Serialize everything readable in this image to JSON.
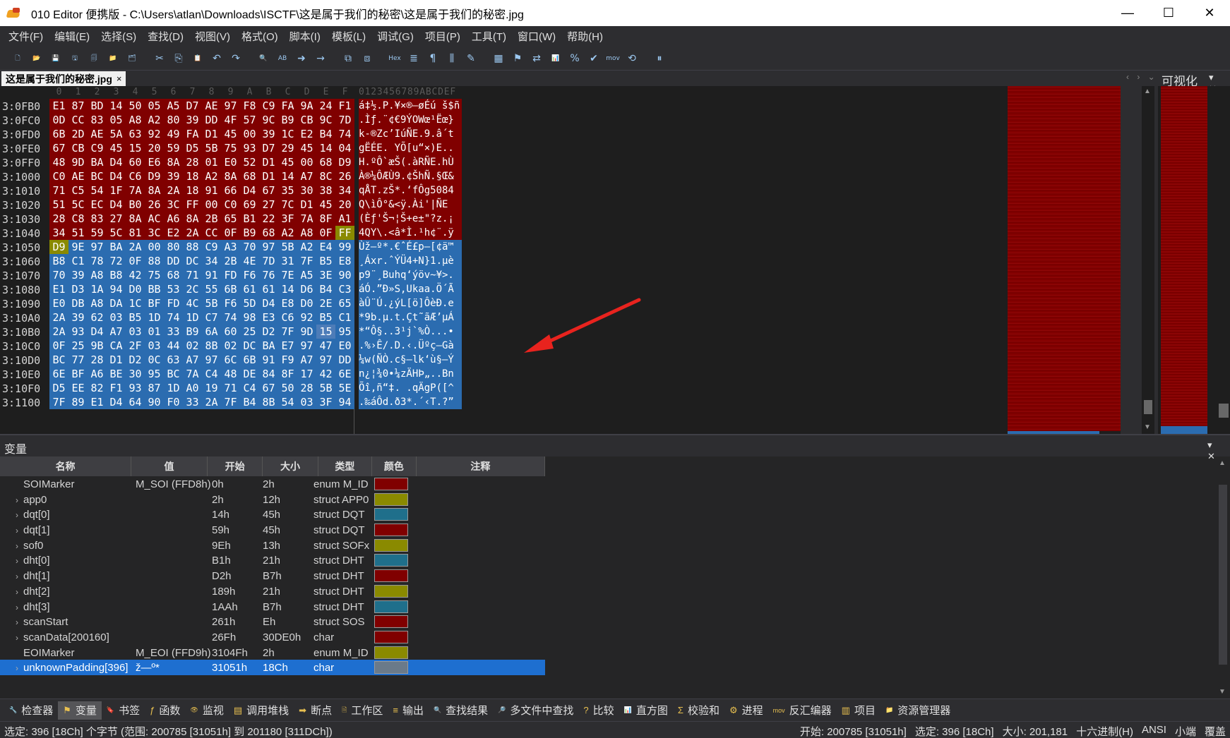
{
  "window": {
    "title": "010 Editor 便携版 - C:\\Users\\atlan\\Downloads\\ISCTF\\这是属于我们的秘密\\这是属于我们的秘密.jpg",
    "min_glyph": "—",
    "max_glyph": "☐",
    "close_glyph": "✕"
  },
  "menu": [
    "文件(F)",
    "编辑(E)",
    "选择(S)",
    "查找(D)",
    "视图(V)",
    "格式(O)",
    "脚本(I)",
    "模板(L)",
    "调试(G)",
    "项目(P)",
    "工具(T)",
    "窗口(W)",
    "帮助(H)"
  ],
  "toolbar": [
    {
      "name": "new-file-icon",
      "glyph": "🗋"
    },
    {
      "name": "open-icon",
      "glyph": "📂"
    },
    {
      "name": "save-icon",
      "glyph": "💾"
    },
    {
      "name": "save-as-icon",
      "glyph": "🖫"
    },
    {
      "name": "save-all-icon",
      "glyph": "🗐"
    },
    {
      "name": "open-folder-icon",
      "glyph": "📁"
    },
    {
      "name": "workspace-icon",
      "glyph": "🗂"
    },
    {
      "name": "cut-icon",
      "glyph": "✂"
    },
    {
      "name": "copy-icon",
      "glyph": "⎘"
    },
    {
      "name": "paste-icon",
      "glyph": "📋"
    },
    {
      "name": "undo-icon",
      "glyph": "↶"
    },
    {
      "name": "redo-icon",
      "glyph": "↷"
    },
    {
      "name": "find-icon",
      "glyph": "🔍"
    },
    {
      "name": "replace-icon",
      "glyph": "AB"
    },
    {
      "name": "find-next-icon",
      "glyph": "➜"
    },
    {
      "name": "goto-icon",
      "glyph": "→"
    },
    {
      "name": "find-in-files-icon",
      "glyph": "⧉"
    },
    {
      "name": "replace-in-files-icon",
      "glyph": "⧈"
    },
    {
      "name": "hex-mode-icon",
      "glyph": "Hex"
    },
    {
      "name": "text-mode-icon",
      "glyph": "≣"
    },
    {
      "name": "pilcrow-icon",
      "glyph": "¶"
    },
    {
      "name": "columns-icon",
      "glyph": "⫼"
    },
    {
      "name": "highlight-icon",
      "glyph": "✎"
    },
    {
      "name": "calculator-icon",
      "glyph": "▦"
    },
    {
      "name": "bookmark-icon",
      "glyph": "⚑"
    },
    {
      "name": "compare-icon",
      "glyph": "⇄"
    },
    {
      "name": "histogram-icon",
      "glyph": "📊"
    },
    {
      "name": "percent-icon",
      "glyph": "%"
    },
    {
      "name": "checksum-icon",
      "glyph": "✔"
    },
    {
      "name": "mov-icon",
      "glyph": "mov"
    },
    {
      "name": "convert-icon",
      "glyph": "⟲"
    },
    {
      "name": "pause-icon",
      "glyph": "⏸"
    }
  ],
  "file_tab": {
    "label": "这是属于我们的秘密.jpg",
    "close": "×"
  },
  "tab_nav": "‹ › ⌄",
  "visualization": {
    "title": "可视化",
    "controls": "▾ ✕"
  },
  "hex": {
    "col_headers": [
      "0",
      "1",
      "2",
      "3",
      "4",
      "5",
      "6",
      "7",
      "8",
      "9",
      "A",
      "B",
      "C",
      "D",
      "E",
      "F"
    ],
    "ascii_header": "0123456789ABCDEF",
    "rows": [
      {
        "addr": "3:0FB0",
        "bytes": [
          "E1",
          "87",
          "BD",
          "14",
          "50",
          "05",
          "A5",
          "D7",
          "AE",
          "97",
          "F8",
          "C9",
          "FA",
          "9A",
          "24",
          "F1"
        ],
        "ascii": "á‡½.P.¥×®—øÉú š$ñ",
        "hl": "r"
      },
      {
        "addr": "3:0FC0",
        "bytes": [
          "0D",
          "CC",
          "83",
          "05",
          "A8",
          "A2",
          "80",
          "39",
          "DD",
          "4F",
          "57",
          "9C",
          "B9",
          "CB",
          "9C",
          "7D"
        ],
        "ascii": ".Ìƒ.¨¢€9ÝOWœ¹Ëœ}",
        "hl": "r"
      },
      {
        "addr": "3:0FD0",
        "bytes": [
          "6B",
          "2D",
          "AE",
          "5A",
          "63",
          "92",
          "49",
          "FA",
          "D1",
          "45",
          "00",
          "39",
          "1C",
          "E2",
          "B4",
          "74"
        ],
        "ascii": "k-®Zc’IúÑE.9.â´t",
        "hl": "r"
      },
      {
        "addr": "3:0FE0",
        "bytes": [
          "67",
          "CB",
          "C9",
          "45",
          "15",
          "20",
          "59",
          "D5",
          "5B",
          "75",
          "93",
          "D7",
          "29",
          "45",
          "14",
          "04"
        ],
        "ascii": "gËÉE. YÕ[u“×)E..",
        "hl": "r"
      },
      {
        "addr": "3:0FF0",
        "bytes": [
          "48",
          "9D",
          "BA",
          "D4",
          "60",
          "E6",
          "8A",
          "28",
          "01",
          "E0",
          "52",
          "D1",
          "45",
          "00",
          "68",
          "D9"
        ],
        "ascii": "H.ºÔ`æŠ(.àRÑE.hÙ",
        "hl": "r"
      },
      {
        "addr": "3:1000",
        "bytes": [
          "C0",
          "AE",
          "BC",
          "D4",
          "C6",
          "D9",
          "39",
          "18",
          "A2",
          "8A",
          "68",
          "D1",
          "14",
          "A7",
          "8C",
          "26"
        ],
        "ascii": "À®¼ÔÆÙ9.¢ŠhÑ.§Œ&",
        "hl": "r"
      },
      {
        "addr": "3:1010",
        "bytes": [
          "71",
          "C5",
          "54",
          "1F",
          "7A",
          "8A",
          "2A",
          "18",
          "91",
          "66",
          "D4",
          "67",
          "35",
          "30",
          "38",
          "34"
        ],
        "ascii": "qÅT.zŠ*.‘fÔg5084",
        "hl": "r"
      },
      {
        "addr": "3:1020",
        "bytes": [
          "51",
          "5C",
          "EC",
          "D4",
          "B0",
          "26",
          "3C",
          "FF",
          "00",
          "C0",
          "69",
          "27",
          "7C",
          "D1",
          "45",
          "20"
        ],
        "ascii": "Q\\ìÔ°&<ÿ.Ài'|ÑE ",
        "hl": "r"
      },
      {
        "addr": "3:1030",
        "bytes": [
          "28",
          "C8",
          "83",
          "27",
          "8A",
          "AC",
          "A6",
          "8A",
          "2B",
          "65",
          "B1",
          "22",
          "3F",
          "7A",
          "8F",
          "A1"
        ],
        "ascii": "(Èƒ'Š¬¦Š+e±\"?z.¡",
        "hl": "r"
      },
      {
        "addr": "3:1040",
        "bytes": [
          "34",
          "51",
          "59",
          "5C",
          "81",
          "3C",
          "E2",
          "2A",
          "CC",
          "0F",
          "B9",
          "68",
          "A2",
          "A8",
          "0F",
          "FF"
        ],
        "ascii": "4QY\\.<â*Ì.¹h¢¨.ÿ",
        "hl": "r",
        "yellow_last": true
      },
      {
        "addr": "3:1050",
        "bytes": [
          "D9",
          "9E",
          "97",
          "BA",
          "2A",
          "00",
          "80",
          "88",
          "C9",
          "A3",
          "70",
          "97",
          "5B",
          "A2",
          "E4",
          "99"
        ],
        "ascii": "Ùž—º*.€ˆÉ£p—[¢ä™",
        "hl": "b",
        "yellow_first": true
      },
      {
        "addr": "3:1060",
        "bytes": [
          "B8",
          "C1",
          "78",
          "72",
          "0F",
          "88",
          "DD",
          "DC",
          "34",
          "2B",
          "4E",
          "7D",
          "31",
          "7F",
          "B5",
          "E8"
        ],
        "ascii": "¸Áxr.ˆÝÜ4+N}1.µè",
        "hl": "b"
      },
      {
        "addr": "3:1070",
        "bytes": [
          "70",
          "39",
          "A8",
          "B8",
          "42",
          "75",
          "68",
          "71",
          "91",
          "FD",
          "F6",
          "76",
          "7E",
          "A5",
          "3E",
          "90"
        ],
        "ascii": "p9¨¸Buhq‘ýöv~¥>.",
        "hl": "b"
      },
      {
        "addr": "3:1080",
        "bytes": [
          "E1",
          "D3",
          "1A",
          "94",
          "D0",
          "BB",
          "53",
          "2C",
          "55",
          "6B",
          "61",
          "61",
          "14",
          "D6",
          "B4",
          "C3"
        ],
        "ascii": "áÓ.”Ð»S,Ukaa.Ö´Ã",
        "hl": "b"
      },
      {
        "addr": "3:1090",
        "bytes": [
          "E0",
          "DB",
          "A8",
          "DA",
          "1C",
          "BF",
          "FD",
          "4C",
          "5B",
          "F6",
          "5D",
          "D4",
          "E8",
          "D0",
          "2E",
          "65"
        ],
        "ascii": "àÛ¨Ú.¿ýL[ö]ÔèÐ.e",
        "hl": "b"
      },
      {
        "addr": "3:10A0",
        "bytes": [
          "2A",
          "39",
          "62",
          "03",
          "B5",
          "1D",
          "74",
          "1D",
          "C7",
          "74",
          "98",
          "E3",
          "C6",
          "92",
          "B5",
          "C1"
        ],
        "ascii": "*9b.µ.t.Çt˜ãÆ’µÁ",
        "hl": "b"
      },
      {
        "addr": "3:10B0",
        "bytes": [
          "2A",
          "93",
          "D4",
          "A7",
          "03",
          "01",
          "33",
          "B9",
          "6A",
          "60",
          "25",
          "D2",
          "7F",
          "9D",
          "15",
          "95"
        ],
        "ascii": "*“Ô§..3¹j`%Ò...•",
        "hl": "b",
        "sel_index": 14
      },
      {
        "addr": "3:10C0",
        "bytes": [
          "0F",
          "25",
          "9B",
          "CA",
          "2F",
          "03",
          "44",
          "02",
          "8B",
          "02",
          "DC",
          "BA",
          "E7",
          "97",
          "47",
          "E0"
        ],
        "ascii": ".%›Ê/.D.‹.Üºç—Gà",
        "hl": "b"
      },
      {
        "addr": "3:10D0",
        "bytes": [
          "BC",
          "77",
          "28",
          "D1",
          "D2",
          "0C",
          "63",
          "A7",
          "97",
          "6C",
          "6B",
          "91",
          "F9",
          "A7",
          "97",
          "DD"
        ],
        "ascii": "¼w(ÑÒ.c§—lk‘ù§—Ý",
        "hl": "b"
      },
      {
        "addr": "3:10E0",
        "bytes": [
          "6E",
          "BF",
          "A6",
          "BE",
          "30",
          "95",
          "BC",
          "7A",
          "C4",
          "48",
          "DE",
          "84",
          "8F",
          "17",
          "42",
          "6E"
        ],
        "ascii": "n¿¦¾0•¼zÄHÞ„..Bn",
        "hl": "b"
      },
      {
        "addr": "3:10F0",
        "bytes": [
          "D5",
          "EE",
          "82",
          "F1",
          "93",
          "87",
          "1D",
          "A0",
          "19",
          "71",
          "C4",
          "67",
          "50",
          "28",
          "5B",
          "5E"
        ],
        "ascii": "Õî‚ñ“‡. .qÄgP([^",
        "hl": "b"
      },
      {
        "addr": "3:1100",
        "bytes": [
          "7F",
          "89",
          "E1",
          "D4",
          "64",
          "90",
          "F0",
          "33",
          "2A",
          "7F",
          "B4",
          "8B",
          "54",
          "03",
          "3F",
          "94"
        ],
        "ascii": ".‰áÔd.ð3*.´‹T.?”",
        "hl": "b"
      }
    ]
  },
  "variables_panel": {
    "title": "变量",
    "controls": "▾ ✕",
    "columns": [
      "名称",
      "值",
      "开始",
      "大小",
      "类型",
      "颜色",
      "注释"
    ],
    "rows": [
      {
        "name": "SOIMarker",
        "value": "M_SOI (FFD8h)",
        "start": "0h",
        "size": "2h",
        "type": "enum M_ID",
        "color": "#800000",
        "expandable": false
      },
      {
        "name": "app0",
        "value": "",
        "start": "2h",
        "size": "12h",
        "type": "struct APP0",
        "color": "#8a8a00",
        "expandable": true
      },
      {
        "name": "dqt[0]",
        "value": "",
        "start": "14h",
        "size": "45h",
        "type": "struct DQT",
        "color": "#1f6f8b",
        "expandable": true
      },
      {
        "name": "dqt[1]",
        "value": "",
        "start": "59h",
        "size": "45h",
        "type": "struct DQT",
        "color": "#800000",
        "expandable": true
      },
      {
        "name": "sof0",
        "value": "",
        "start": "9Eh",
        "size": "13h",
        "type": "struct SOFx",
        "color": "#8a8a00",
        "expandable": true
      },
      {
        "name": "dht[0]",
        "value": "",
        "start": "B1h",
        "size": "21h",
        "type": "struct DHT",
        "color": "#1f6f8b",
        "expandable": true
      },
      {
        "name": "dht[1]",
        "value": "",
        "start": "D2h",
        "size": "B7h",
        "type": "struct DHT",
        "color": "#800000",
        "expandable": true
      },
      {
        "name": "dht[2]",
        "value": "",
        "start": "189h",
        "size": "21h",
        "type": "struct DHT",
        "color": "#8a8a00",
        "expandable": true
      },
      {
        "name": "dht[3]",
        "value": "",
        "start": "1AAh",
        "size": "B7h",
        "type": "struct DHT",
        "color": "#1f6f8b",
        "expandable": true
      },
      {
        "name": "scanStart",
        "value": "",
        "start": "261h",
        "size": "Eh",
        "type": "struct SOS",
        "color": "#800000",
        "expandable": true
      },
      {
        "name": "scanData[200160]",
        "value": "",
        "start": "26Fh",
        "size": "30DE0h",
        "type": "char",
        "color": "#800000",
        "expandable": true
      },
      {
        "name": "EOIMarker",
        "value": "M_EOI (FFD9h)",
        "start": "3104Fh",
        "size": "2h",
        "type": "enum M_ID",
        "color": "#8a8a00",
        "expandable": false
      },
      {
        "name": "unknownPadding[396]",
        "value": "ž—º*",
        "start": "31051h",
        "size": "18Ch",
        "type": "char",
        "color": "#6a7a8a",
        "expandable": true,
        "selected": true
      }
    ]
  },
  "bottom_tabs": [
    {
      "label": "检查器",
      "icon": "🔧",
      "name": "tab-inspector"
    },
    {
      "label": "变量",
      "icon": "⚑",
      "name": "tab-variables",
      "active": true
    },
    {
      "label": "书签",
      "icon": "🔖",
      "name": "tab-bookmarks"
    },
    {
      "label": "函数",
      "icon": "ƒ",
      "name": "tab-functions"
    },
    {
      "label": "监视",
      "icon": "👁",
      "name": "tab-watch"
    },
    {
      "label": "调用堆栈",
      "icon": "▤",
      "name": "tab-call-stack"
    },
    {
      "label": "断点",
      "icon": "➡",
      "name": "tab-breakpoints"
    },
    {
      "label": "工作区",
      "icon": "🗎",
      "name": "tab-workspace"
    },
    {
      "label": "输出",
      "icon": "≡",
      "name": "tab-output"
    },
    {
      "label": "查找结果",
      "icon": "🔍",
      "name": "tab-find-results"
    },
    {
      "label": "多文件中查找",
      "icon": "🔎",
      "name": "tab-find-in-files"
    },
    {
      "label": "比较",
      "icon": "?",
      "name": "tab-compare"
    },
    {
      "label": "直方图",
      "icon": "📊",
      "name": "tab-histogram"
    },
    {
      "label": "校验和",
      "icon": "Σ",
      "name": "tab-checksum"
    },
    {
      "label": "进程",
      "icon": "⚙",
      "name": "tab-processes"
    },
    {
      "label": "反汇编器",
      "icon": "mov",
      "name": "tab-disassembler"
    },
    {
      "label": "项目",
      "icon": "▥",
      "name": "tab-project"
    },
    {
      "label": "资源管理器",
      "icon": "📁",
      "name": "tab-explorer"
    }
  ],
  "status": {
    "left": "选定: 396 [18Ch] 个字节 (范围: 200785 [31051h] 到 201180 [311DCh])",
    "start": "开始: 200785 [31051h]",
    "selected": "选定: 396 [18Ch]",
    "size": "大小: 201,181",
    "mode": "十六进制(H)",
    "encoding": "ANSI",
    "endian": "小端",
    "overwrite": "覆盖"
  },
  "colors": {
    "red": "#800000",
    "blue": "#2b6cb0",
    "yellow": "#8a8a00"
  }
}
